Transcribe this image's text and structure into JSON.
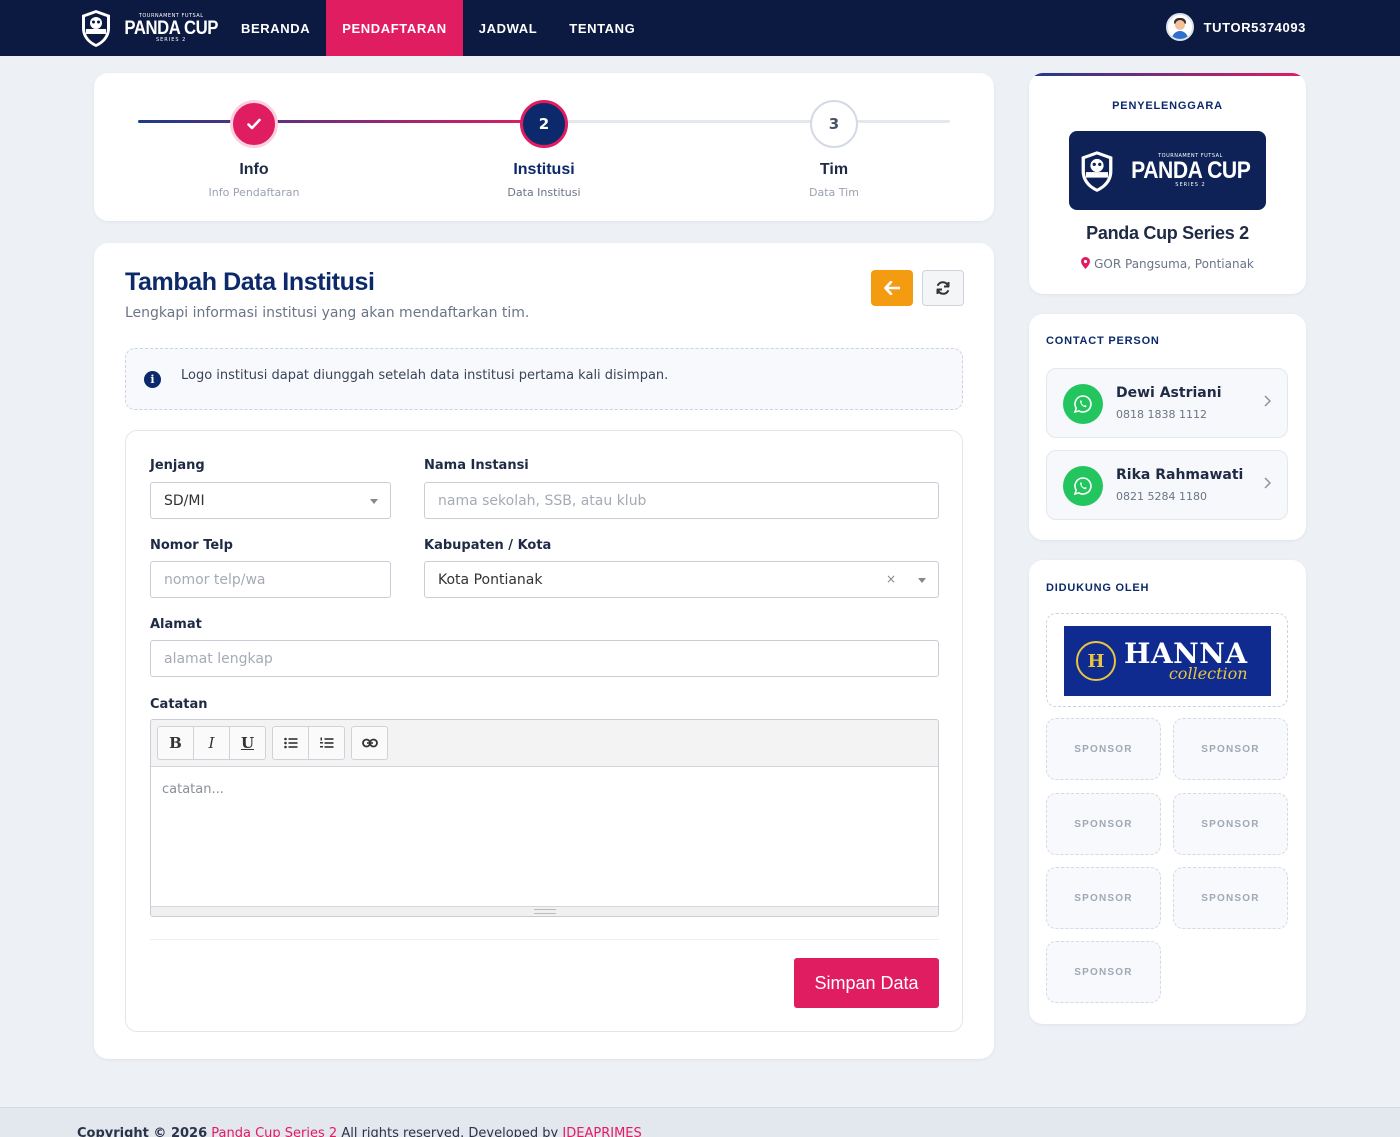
{
  "navbar": {
    "brand": {
      "tagline": "TOURNAMENT FUTSAL",
      "name": "PANDA CUP",
      "series": "SERIES 2",
      "shield_text": "PANDA CUP"
    },
    "links": [
      {
        "label": "BERANDA",
        "active": false
      },
      {
        "label": "PENDAFTARAN",
        "active": true
      },
      {
        "label": "JADWAL",
        "active": false
      },
      {
        "label": "TENTANG",
        "active": false
      }
    ],
    "user": "TUTOR5374093"
  },
  "stepper": {
    "steps": [
      {
        "number": "",
        "title": "Info",
        "subtitle": "Info Pendaftaran",
        "state": "done"
      },
      {
        "number": "2",
        "title": "Institusi",
        "subtitle": "Data Institusi",
        "state": "active"
      },
      {
        "number": "3",
        "title": "Tim",
        "subtitle": "Data Tim",
        "state": "pending"
      }
    ],
    "progress_percent": 50
  },
  "form": {
    "title": "Tambah Data Institusi",
    "subtitle": "Lengkapi informasi institusi yang akan mendaftarkan tim.",
    "info": "Logo institusi dapat diunggah setelah data institusi pertama kali disimpan.",
    "fields": {
      "jenjang": {
        "label": "Jenjang",
        "value": "SD/MI"
      },
      "nama_instansi": {
        "label": "Nama Instansi",
        "placeholder": "nama sekolah, SSB, atau klub"
      },
      "nomor_telp": {
        "label": "Nomor Telp",
        "placeholder": "nomor telp/wa"
      },
      "kabupaten": {
        "label": "Kabupaten / Kota",
        "value": "Kota Pontianak",
        "clear": "×"
      },
      "alamat": {
        "label": "Alamat",
        "placeholder": "alamat lengkap"
      },
      "catatan": {
        "label": "Catatan",
        "placeholder": "catatan..."
      }
    },
    "toolbar": {
      "bold": "B",
      "italic": "I",
      "underline": "U"
    },
    "save_label": "Simpan Data"
  },
  "sidebar": {
    "organizer": {
      "title": "PENYELENGGARA",
      "name": "Panda Cup Series 2",
      "location": "GOR Pangsuma, Pontianak"
    },
    "contacts": {
      "title": "CONTACT PERSON",
      "items": [
        {
          "name": "Dewi Astriani",
          "phone": "0818 1838 1112"
        },
        {
          "name": "Rika Rahmawati",
          "phone": "0821 5284 1180"
        }
      ]
    },
    "sponsors": {
      "title": "DIDUKUNG OLEH",
      "main": {
        "name": "HANNA",
        "sub": "collection",
        "badge": "H"
      },
      "placeholders": [
        "SPONSOR",
        "SPONSOR",
        "SPONSOR",
        "SPONSOR",
        "SPONSOR",
        "SPONSOR",
        "SPONSOR"
      ]
    }
  },
  "footer": {
    "prefix": "Copyright © 2026",
    "site": "Panda Cup Series 2",
    "middle": "All rights reserved. Developed by",
    "developer": "IDEAPRIMES"
  },
  "colors": {
    "navy": "#0c1a42",
    "accent": "#e11d62",
    "warning": "#f39c12",
    "whatsapp": "#22c55e"
  }
}
